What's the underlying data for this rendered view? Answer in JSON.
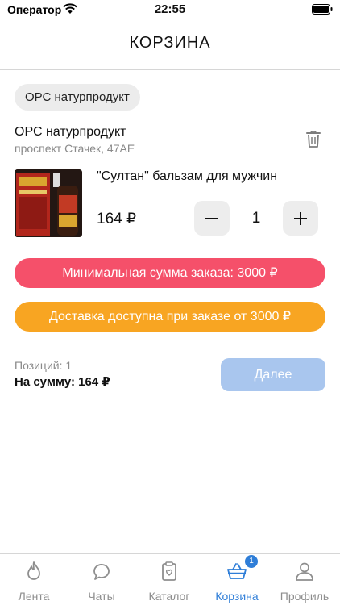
{
  "status_bar": {
    "carrier": "Оператор",
    "time": "22:55"
  },
  "header": {
    "title": "КОРЗИНА"
  },
  "store": {
    "chip_label": "ОРС натурпродукт",
    "name": "ОРС натурпродукт",
    "address": "проспект Стачек, 47АЕ"
  },
  "product": {
    "name": "\"Султан\" бальзам для мужчин",
    "price": "164 ₽",
    "quantity": "1"
  },
  "banners": {
    "min_order": "Минимальная сумма заказа: 3000 ₽",
    "delivery": "Доставка доступна при заказе от 3000 ₽"
  },
  "summary": {
    "positions": "Позиций: 1",
    "total": "На сумму: 164 ₽",
    "next_label": "Далее"
  },
  "tabs": [
    {
      "label": "Лента",
      "icon": "flame-icon",
      "active": false
    },
    {
      "label": "Чаты",
      "icon": "chat-icon",
      "active": false
    },
    {
      "label": "Каталог",
      "icon": "catalog-icon",
      "active": false
    },
    {
      "label": "Корзина",
      "icon": "basket-icon",
      "active": true,
      "badge": "1"
    },
    {
      "label": "Профиль",
      "icon": "profile-icon",
      "active": false
    }
  ],
  "colors": {
    "accent": "#2f7ed8",
    "min_banner": "#f5506a",
    "delivery_banner": "#f8a522",
    "next_disabled": "#a9c6ee"
  }
}
